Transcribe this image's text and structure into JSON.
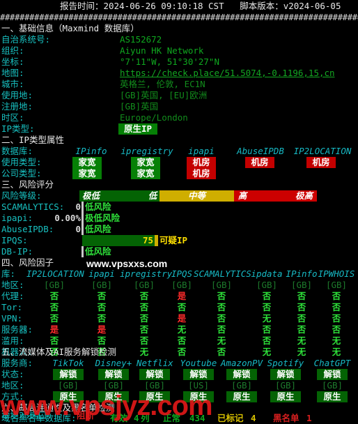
{
  "header": {
    "report_time_label": "报告时间：",
    "report_time": "2024-06-26 09:10:18 CST",
    "script_version_label": "脚本版本：",
    "script_version": "v2024-06-05",
    "divider": "################################################################################"
  },
  "section1": {
    "title": "一、基础信息（Maxmind 数据库）",
    "rows": [
      {
        "label": "自治系统号:",
        "value": "AS152672"
      },
      {
        "label": "组织:",
        "value": "Aiyun HK Network"
      },
      {
        "label": "坐标:",
        "value": "°7'11\"W, 51°30'27\"N"
      },
      {
        "label": "地图:",
        "value": "https://check.place/51.5074,-0.1196,15,cn"
      },
      {
        "label": "城市:",
        "value": "英格兰, 伦敦, EC1N"
      },
      {
        "label": "使用地:",
        "value": "[GB]英国, [EU]欧洲"
      },
      {
        "label": "注册地:",
        "value": "[GB]英国"
      },
      {
        "label": "时区:",
        "value": "Europe/London"
      },
      {
        "label": "IP类型:",
        "value": "原生IP"
      }
    ]
  },
  "section2": {
    "title": "二、IP类型属性",
    "db_label": "数据库:",
    "usage_label": "使用类型:",
    "company_label": "公司类型:",
    "databases": [
      "IPinfo",
      "ipregistry",
      "ipapi",
      "AbuseIPDB",
      "IP2LOCATION"
    ],
    "usage_type": [
      "家宽",
      "家宽",
      "机房",
      "机房",
      "机房"
    ],
    "company_type": [
      "家宽",
      "家宽",
      "机房",
      "",
      ""
    ]
  },
  "section3": {
    "title": "三、风险评分",
    "risk_level_label": "风险等级:",
    "scale": [
      {
        "label": "极低",
        "color": "#046304"
      },
      {
        "label": "低",
        "color": "#046304"
      },
      {
        "label": "中等",
        "color": "#cfae00"
      },
      {
        "label": "高",
        "color": "#cc0000"
      },
      {
        "label": "极高",
        "color": "#cc0000"
      }
    ],
    "scores": [
      {
        "label": "SCAMALYTICS:",
        "value": "0",
        "verdict": "低风险",
        "bar_pct": 0,
        "suspicious": false
      },
      {
        "label": "ipapi:",
        "value": "0.00%",
        "verdict": "极低风险",
        "bar_pct": 0,
        "suspicious": false
      },
      {
        "label": "AbuseIPDB:",
        "value": "0",
        "verdict": "低风险",
        "bar_pct": 0,
        "suspicious": false
      },
      {
        "label": "IPQS:",
        "value": "75",
        "verdict": "可疑IP",
        "bar_pct": 75,
        "suspicious": true
      },
      {
        "label": "DB-IP:",
        "value": "",
        "verdict": "低风险",
        "bar_pct": 0,
        "suspicious": false
      }
    ]
  },
  "section4": {
    "title": "四、风险因子",
    "watermark": "www.vpsxxs.com",
    "db_label": "库:",
    "databases": [
      "IP2LOCATION",
      "ipapi",
      "ipregistry",
      "IPQS",
      "SCAMALYTICS",
      "ipdata",
      "IPinfo",
      "IPWHOIS"
    ],
    "rows": [
      {
        "label": "地区:",
        "values": [
          "[GB]",
          "[GB]",
          "[GB]",
          "[GB]",
          "[GB]",
          "[GB]",
          "[GB]",
          "[GB]"
        ]
      },
      {
        "label": "代理:",
        "values": [
          "否",
          "否",
          "否",
          "是",
          "否",
          "否",
          "否",
          "否"
        ]
      },
      {
        "label": "Tor:",
        "values": [
          "否",
          "否",
          "否",
          "否",
          "否",
          "否",
          "否",
          "否"
        ]
      },
      {
        "label": "VPN:",
        "values": [
          "否",
          "否",
          "否",
          "是",
          "否",
          "无",
          "否",
          "否"
        ]
      },
      {
        "label": "服务器:",
        "values": [
          "是",
          "是",
          "否",
          "无",
          "否",
          "否",
          "否",
          "否"
        ]
      },
      {
        "label": "滥用:",
        "values": [
          "否",
          "否",
          "否",
          "否",
          "无",
          "否",
          "无",
          "无"
        ]
      },
      {
        "label": "机器人:",
        "values": [
          "否",
          "否",
          "无",
          "否",
          "否",
          "无",
          "无",
          "无"
        ]
      }
    ]
  },
  "section5": {
    "title": "五、流媒体及AI服务解锁检测",
    "provider_label": "服务商:",
    "status_label": "状态:",
    "region_label": "地区:",
    "method_label": "方式:",
    "providers": [
      "TikTok",
      "Disney+",
      "Netflix",
      "Youtube",
      "AmazonPV",
      "Spotify",
      "ChatGPT"
    ],
    "status": [
      "解锁",
      "解锁",
      "解锁",
      "解锁",
      "解锁",
      "解锁",
      "解锁"
    ],
    "regions": [
      "[GB]",
      "[GB]",
      "[GB]",
      "[US]",
      "[GB]",
      "[GB]",
      "[GB]"
    ],
    "methods": [
      "原生",
      "原生",
      "原生",
      "原生",
      "原生",
      "原生",
      "原生"
    ]
  },
  "section6": {
    "title": "六、邮局连通性及黑名单检测",
    "port25_label": "本地25端口:",
    "port25_value": "阻断",
    "blacklist_label": "域名黑名单数据库:",
    "blacklist_valid_label": "有效",
    "blacklist_valid": "4",
    "blacklist_suffix": "列",
    "normal_label": "正常",
    "normal_count": "434",
    "flagged_label": "已标记",
    "flagged_count": "4",
    "blacklisted_label": "黑名单",
    "blacklisted_count": "1"
  },
  "watermark_big": "www.vpsjyz.com"
}
